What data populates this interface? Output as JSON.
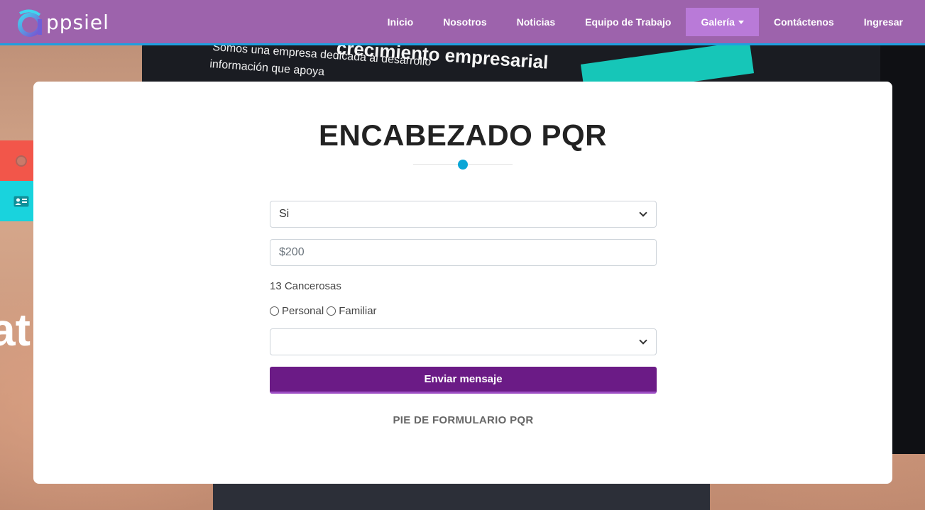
{
  "brand": {
    "logo_text": "ppsiel",
    "colors": {
      "navbar": "#9d63ac",
      "accent": "#1ea0e0",
      "active_nav": "#b97ad8",
      "submit": "#6b1b86"
    }
  },
  "nav": {
    "items": [
      {
        "label": "Inicio"
      },
      {
        "label": "Nosotros"
      },
      {
        "label": "Noticias"
      },
      {
        "label": "Equipo de Trabajo"
      },
      {
        "label": "Galería"
      },
      {
        "label": "Contáctenos"
      },
      {
        "label": "Ingresar"
      }
    ],
    "active_index": 4
  },
  "background": {
    "line1": "Somos una empresa dedicada al desarrollo",
    "line2": "información que apoya",
    "headline": "crecimiento empresarial",
    "big_letters": "at"
  },
  "side_buttons": [
    {
      "icon": "circle-icon",
      "color": "#f2564a"
    },
    {
      "icon": "id-card-icon",
      "color": "#19d3dd"
    }
  ],
  "card": {
    "title": "ENCABEZADO PQR",
    "form": {
      "select1_value": "Si",
      "amount_placeholder": "$200",
      "label": "13 Cancerosas",
      "radio_options": [
        "Personal",
        "Familiar"
      ],
      "select2_value": "",
      "submit_label": "Enviar mensaje"
    },
    "footer": "PIE DE FORMULARIO PQR"
  }
}
